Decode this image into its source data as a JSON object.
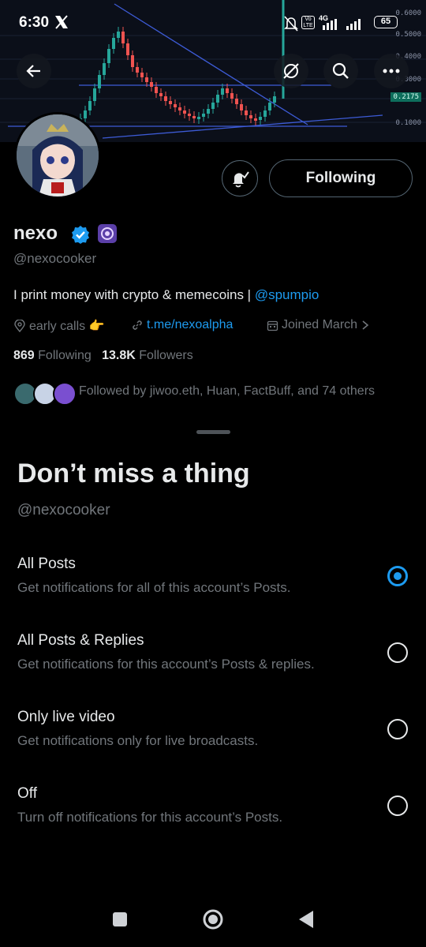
{
  "status_bar": {
    "time": "6:30",
    "network": "4G",
    "volte": "Vo LTE",
    "battery": "65"
  },
  "banner_chart": {
    "price_ticks": [
      "0.6000",
      "0.5000",
      "0.4000",
      "0.3000",
      "0.2175",
      "0.1000"
    ],
    "current_price": "0.2175"
  },
  "header_buttons": {
    "back_icon": "arrow-left-icon",
    "hide_icon": "eye-off-circle-icon",
    "search_icon": "search-icon",
    "more_icon": "more-horizontal-icon"
  },
  "profile": {
    "name": "nexo",
    "verified": true,
    "handle": "@nexocooker",
    "bio_text": "I print money with crypto & memecoins | ",
    "bio_mention": "@spumpio",
    "location": "early calls 👉",
    "website": "t.me/nexoalpha",
    "joined": "Joined March",
    "following_count": "869",
    "following_label": "Following",
    "followers_count": "13.8K",
    "followers_label": "Followers",
    "followed_by": "Followed by jiwoo.eth, Huan, FactBuff, and 74 others",
    "following_button": "Following"
  },
  "sheet": {
    "title": "Don’t miss a thing",
    "handle": "@nexocooker",
    "options": [
      {
        "title": "All Posts",
        "desc": "Get notifications for all of this account’s Posts.",
        "selected": true
      },
      {
        "title": "All Posts & Replies",
        "desc": "Get notifications for this account’s Posts & replies.",
        "selected": false
      },
      {
        "title": "Only live video",
        "desc": "Get notifications only for live broadcasts.",
        "selected": false
      },
      {
        "title": "Off",
        "desc": "Turn off notifications for this account’s Posts.",
        "selected": false
      }
    ]
  },
  "colors": {
    "accent": "#1d9bf0",
    "background": "#000000",
    "muted_text": "#71767b",
    "primary_text": "#e7e9ea"
  }
}
